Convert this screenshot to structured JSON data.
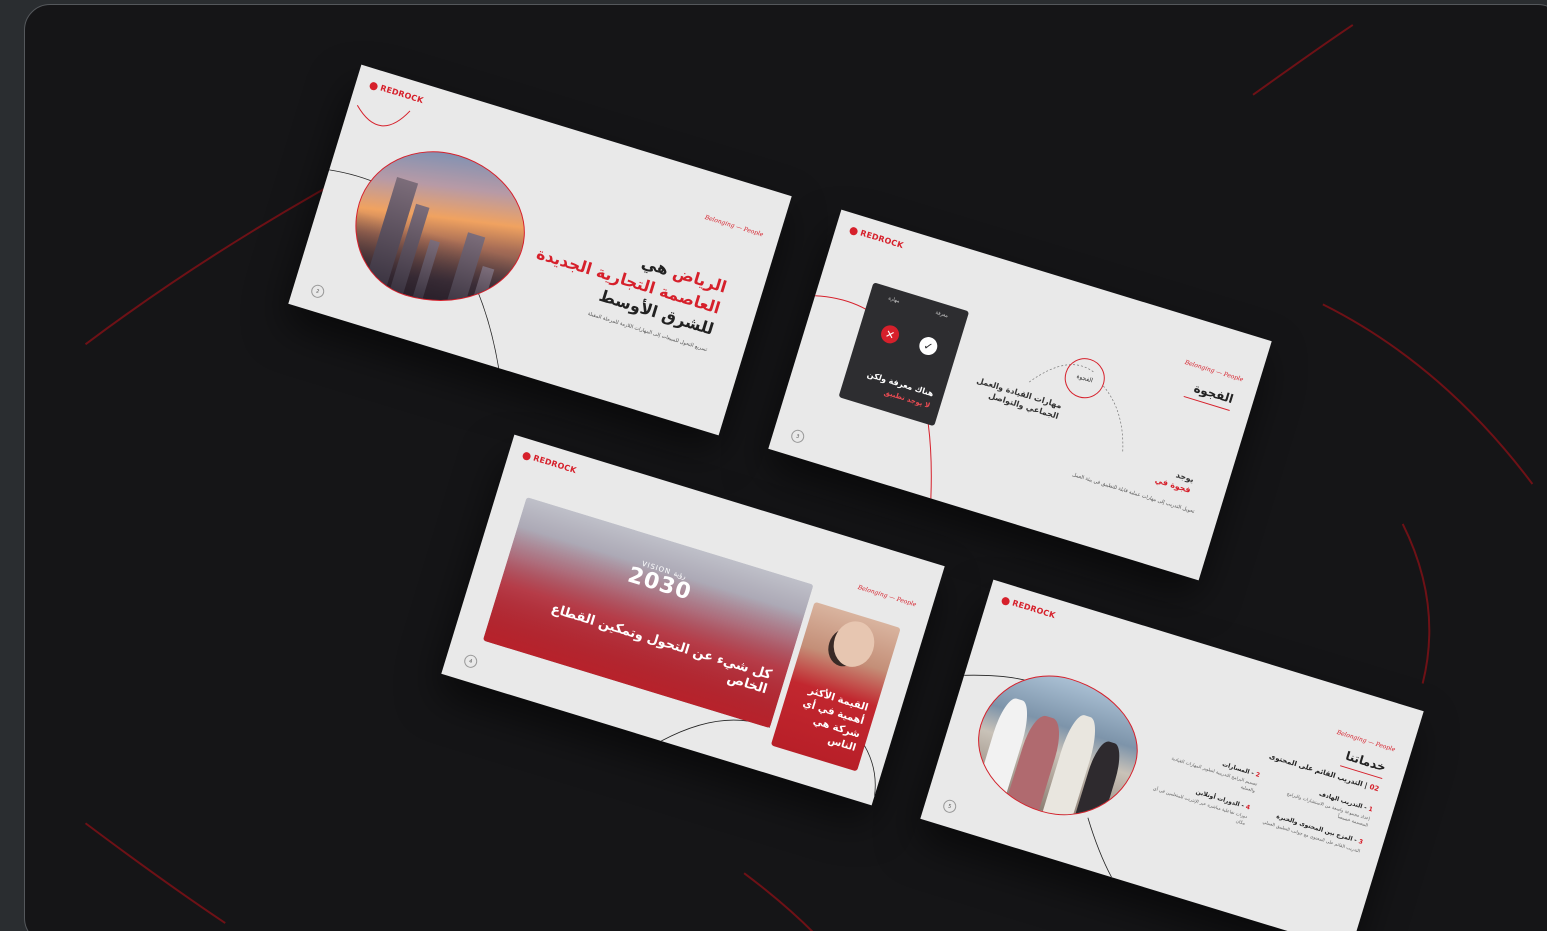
{
  "brand": {
    "logo_text": "REDROCK",
    "tagline": "Belonging — People",
    "accent": "#d6202b",
    "background": "#151517"
  },
  "slide1": {
    "page_number": "2",
    "title_line1_dark": "هي",
    "title_line1_red": "الرياض",
    "title_line2": "العاصمة التجارية الجديدة",
    "title_line3": "للشرق الأوسط",
    "subtitle": "تسريع التحول للمبيعات إلى المهارات اللازمة للمرحلة المقبلة"
  },
  "slide2": {
    "page_number": "3",
    "heading": "الفجوة",
    "card_label_knowledge": "معرفة",
    "card_label_skill": "مهارة",
    "card_text_knowledge": "هناك معرفة ولكن",
    "card_text_nouse": "لا يوجد تطبيق",
    "gap_circle": "الفجوة",
    "skills": "مهارات القيادة والعمل الجماعي والتواصل",
    "exists_line1": "يوجد",
    "exists_line2": "فجوة في",
    "description": "تحويل التدريب إلى مهارات عملية قابلة للتطبيق في بيئة العمل"
  },
  "slide3": {
    "page_number": "4",
    "vision_small": "VISION رؤية",
    "vision_big": "2030",
    "banner_text": "كل شيء عن التحول وتمكين القطاع الخاص",
    "card_text": "القيمة الأكثر أهمية في أي شركة هي الناس"
  },
  "slide4": {
    "page_number": "5",
    "title": "خدماتنا",
    "subtitle_num": "02",
    "subtitle": "التدريب القائم على المحتوى",
    "items": [
      {
        "num": "1",
        "title": "التدريب الهادف",
        "desc": "إعداد مجموعة واسعة من الاستشارات والبرامج المصممة خصيصاً"
      },
      {
        "num": "2",
        "title": "المسارات",
        "desc": "تصميم البرامج التدريبية لتطوير المهارات القيادية والعملية"
      },
      {
        "num": "3",
        "title": "المزج بين المحتوى والخبرة",
        "desc": "التدريب القائم على المحتوى مع جوانب التطبيق العملي"
      },
      {
        "num": "4",
        "title": "الدورات أونلاين",
        "desc": "دورات تفاعلية مباشرة عبر الإنترنت للمتعلمين في أي مكان"
      }
    ]
  }
}
